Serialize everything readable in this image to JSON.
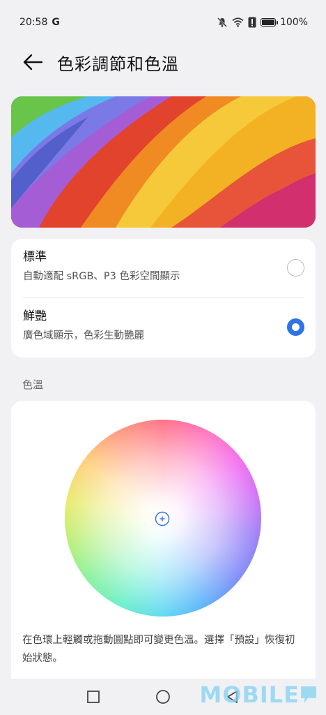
{
  "status_bar": {
    "time": "20:58",
    "carrier_letter": "G",
    "battery_percent": "100%",
    "icons": [
      "mute-bell-icon",
      "wifi-icon",
      "alert-icon",
      "battery-icon"
    ]
  },
  "header": {
    "title": "色彩調節和色溫",
    "back_icon": "arrow-left-icon"
  },
  "color_modes": {
    "options": [
      {
        "label": "標準",
        "description": "自動適配 sRGB、P3 色彩空間顯示",
        "selected": false
      },
      {
        "label": "鮮艷",
        "description": "廣色域顯示，色彩生動艷麗",
        "selected": true
      }
    ]
  },
  "color_temperature": {
    "section_label": "色溫",
    "description": "在色環上輕觸或拖動圓點即可變更色溫。選擇「預設」恢復初始狀態。"
  },
  "nav_bar": {
    "icons": [
      "recents-square-icon",
      "home-circle-icon",
      "back-triangle-icon"
    ]
  },
  "watermark": {
    "text": "MOBILE"
  },
  "colors": {
    "accent": "#2f73e6",
    "background": "#f1f1f4",
    "card": "#ffffff"
  }
}
